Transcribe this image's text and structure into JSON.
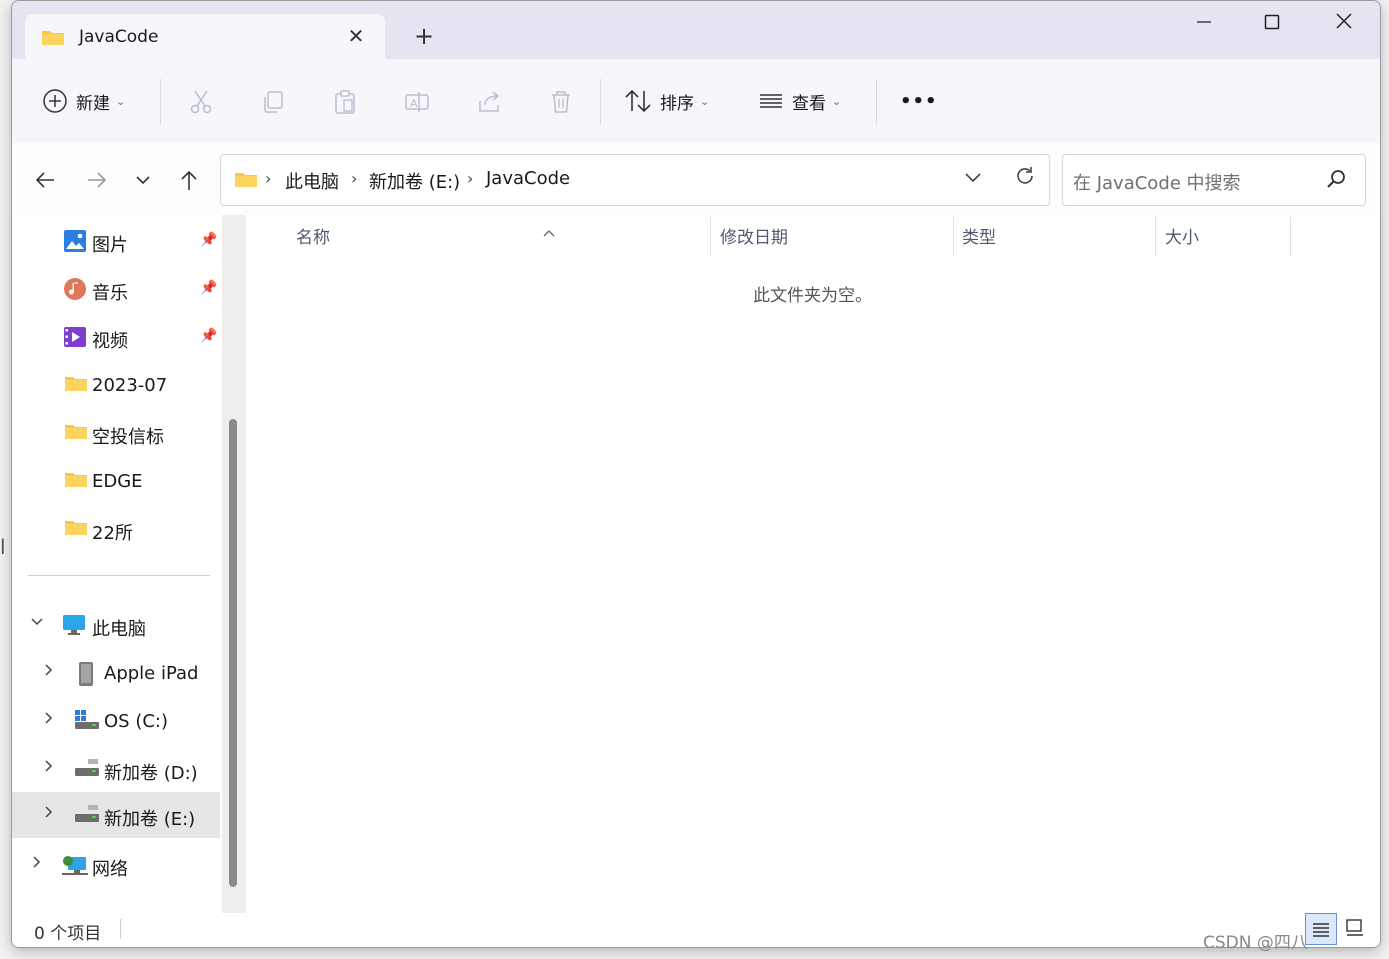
{
  "tab": {
    "title": "JavaCode",
    "close": "✕",
    "new_tab": "+"
  },
  "window_controls": {
    "minimize": "—",
    "maximize": "☐",
    "close": "✕"
  },
  "toolbar": {
    "new_label": "新建",
    "sort_label": "排序",
    "view_label": "查看",
    "more": "•••"
  },
  "address": {
    "crumbs": [
      "此电脑",
      "新加卷 (E:)",
      "JavaCode"
    ],
    "sep": "›"
  },
  "search": {
    "placeholder": "在 JavaCode 中搜索"
  },
  "sidebar": {
    "quick_access": [
      {
        "label": "图片",
        "icon": "pictures-icon"
      },
      {
        "label": "音乐",
        "icon": "music-icon"
      },
      {
        "label": "视频",
        "icon": "videos-icon"
      },
      {
        "label": "2023-07",
        "icon": "folder-icon"
      },
      {
        "label": "空投信标",
        "icon": "folder-icon"
      },
      {
        "label": "EDGE",
        "icon": "folder-icon"
      },
      {
        "label": "22所",
        "icon": "folder-icon"
      }
    ],
    "tree": [
      {
        "label": "此电脑",
        "icon": "this-pc-icon"
      },
      {
        "label": "Apple iPad",
        "icon": "ipad-icon"
      },
      {
        "label": "OS (C:)",
        "icon": "drive-c-icon"
      },
      {
        "label": "新加卷 (D:)",
        "icon": "drive-icon"
      },
      {
        "label": "新加卷 (E:)",
        "icon": "drive-icon"
      },
      {
        "label": "网络",
        "icon": "network-icon"
      }
    ]
  },
  "columns": {
    "name": "名称",
    "modified": "修改日期",
    "type": "类型",
    "size": "大小"
  },
  "empty_message": "此文件夹为空。",
  "status": {
    "count": "0 个项目"
  },
  "watermark": "CSDN @四八",
  "background_fragment": "l",
  "colors": {
    "titlebar": "#e7e3f1",
    "toolbar": "#f7f6fa",
    "selected": "#e6e6e6",
    "folder": "#f6c84a"
  }
}
